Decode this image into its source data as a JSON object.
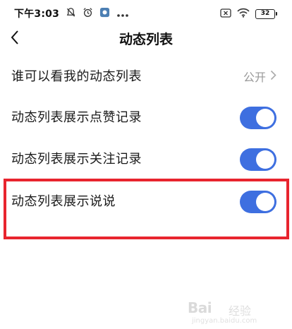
{
  "status_bar": {
    "time": "下午3:03",
    "battery": "32",
    "icons": [
      "mute-bell-icon",
      "alarm-icon",
      "app-notification-icon",
      "more-dots-icon",
      "sim-off-icon",
      "wifi-icon",
      "battery-icon"
    ]
  },
  "nav": {
    "title": "动态列表",
    "back_icon": "chevron-left-icon"
  },
  "settings": [
    {
      "label": "谁可以看我的动态列表",
      "value": "公开",
      "control": "chevron-right-icon"
    },
    {
      "label": "动态列表展示点赞记录",
      "control": "toggle",
      "on": true
    },
    {
      "label": "动态列表展示关注记录",
      "control": "toggle",
      "on": true
    },
    {
      "label": "动态列表展示说说",
      "control": "toggle",
      "on": true,
      "highlighted": true
    }
  ],
  "colors": {
    "toggle_on": "#3e6fe0",
    "highlight_border": "#e8242e",
    "secondary_text": "#999999"
  },
  "watermark": {
    "brand": "Bai",
    "brand_suffix": "经验",
    "url": "jingyan.baidu.com"
  }
}
